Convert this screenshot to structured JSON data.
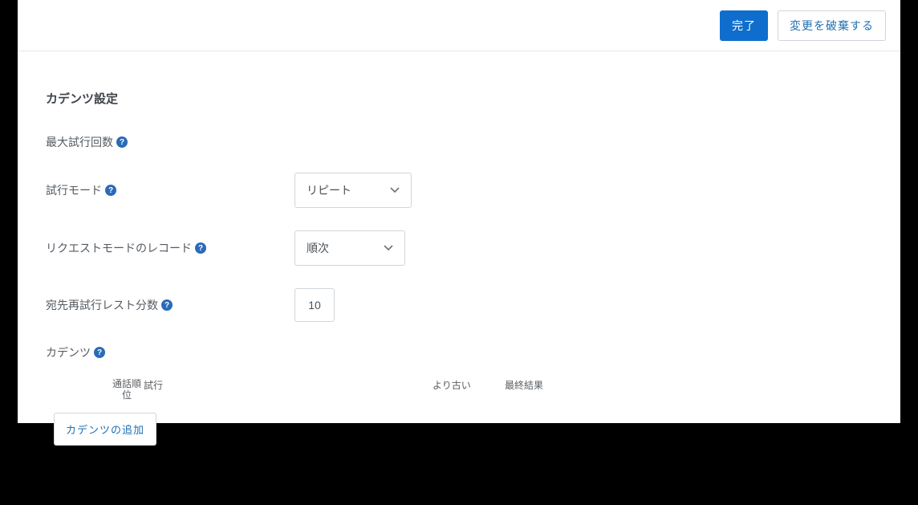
{
  "header": {
    "done": "完了",
    "discard": "変更を破棄する"
  },
  "section": {
    "title": "カデンツ設定"
  },
  "fields": {
    "maxAttempts": {
      "label": "最大試行回数"
    },
    "attemptMode": {
      "label": "試行モード",
      "value": "リピート"
    },
    "requestRecordMode": {
      "label": "リクエストモードのレコード",
      "value": "順次"
    },
    "retryRestMinutes": {
      "label": "宛先再試行レスト分数",
      "value": "10"
    },
    "cadence": {
      "label": "カデンツ"
    }
  },
  "columns": {
    "callRank": "通話順位",
    "attempt": "試行",
    "older": "より古い",
    "finalResult": "最終結果"
  },
  "buttons": {
    "addCadence": "カデンツの追加"
  }
}
